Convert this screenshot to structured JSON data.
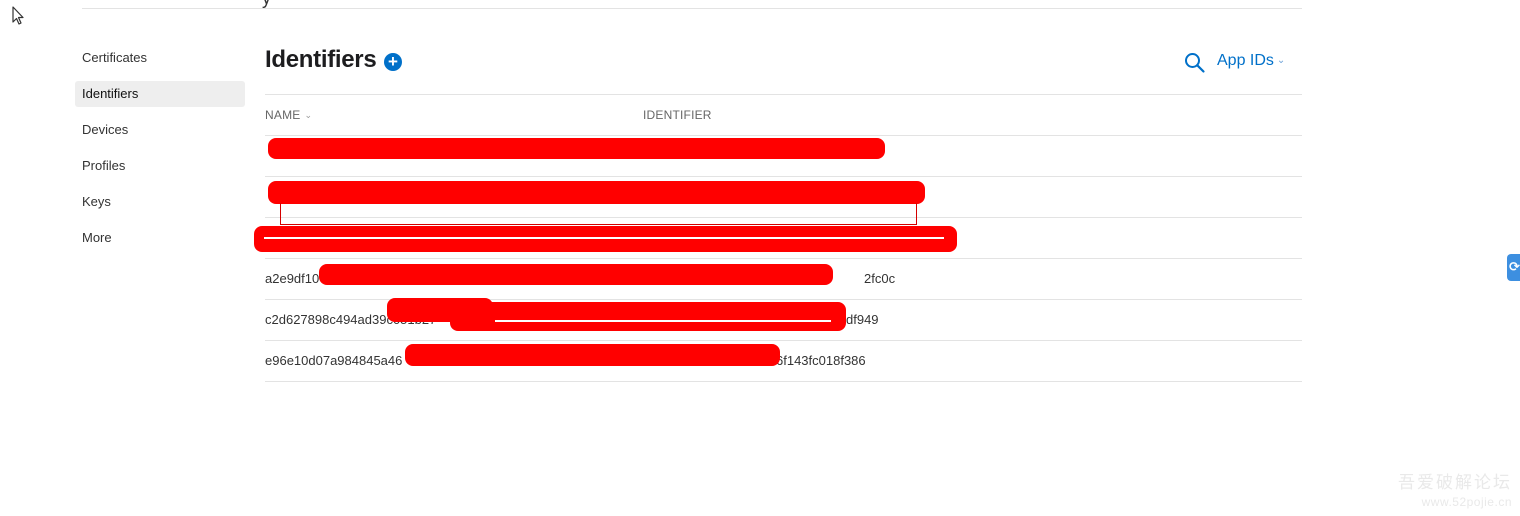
{
  "sidebar": {
    "items": [
      {
        "label": "Certificates",
        "active": false
      },
      {
        "label": "Identifiers",
        "active": true
      },
      {
        "label": "Devices",
        "active": false
      },
      {
        "label": "Profiles",
        "active": false
      },
      {
        "label": "Keys",
        "active": false
      },
      {
        "label": "More",
        "active": false
      }
    ]
  },
  "header": {
    "title": "Identifiers",
    "add_icon": "plus-circle-icon",
    "search_icon": "search-icon",
    "filter_label": "App IDs"
  },
  "table": {
    "columns": {
      "name": "NAME",
      "identifier": "IDENTIFIER"
    },
    "rows": [
      {
        "name": "",
        "identifier": ""
      },
      {
        "name": "",
        "identifier": ""
      },
      {
        "name": "",
        "identifier": ""
      },
      {
        "name": "a2e9df10",
        "identifier": "2fc0c"
      },
      {
        "name": "c2d627898c494ad39c051b27",
        "identifier": "df949"
      },
      {
        "name": "e96e10d07a984845a46",
        "identifier": "6f143fc018f386"
      }
    ]
  },
  "watermark": {
    "line1": "吾爱破解论坛",
    "line2": "www.52pojie.cn"
  },
  "colors": {
    "accent": "#0070c9",
    "redaction": "#ff0000"
  }
}
